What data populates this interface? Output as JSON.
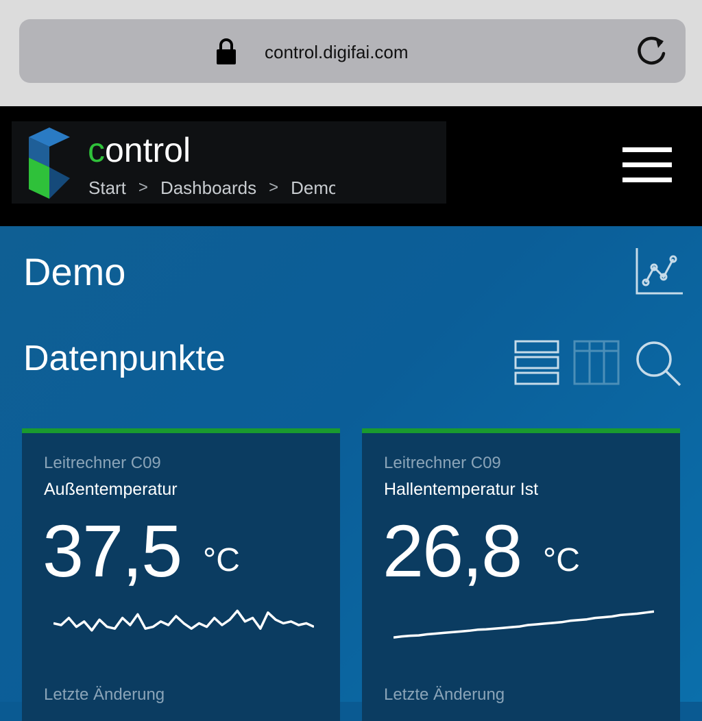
{
  "browser": {
    "url": "control.digifai.com"
  },
  "header": {
    "brand_accent": "c",
    "brand_rest": "ontrol",
    "breadcrumb": [
      "Start",
      "Dashboards",
      "Demo"
    ],
    "accent_color": "#2fc13a"
  },
  "page": {
    "title": "Demo",
    "section_title": "Datenpunkte"
  },
  "cards": [
    {
      "source": "Leitrechner C09",
      "name": "Außentemperatur",
      "value": "37,5",
      "unit": "°C",
      "changed_label": "Letzte Änderung",
      "spark": [
        0.45,
        0.5,
        0.3,
        0.55,
        0.4,
        0.65,
        0.35,
        0.55,
        0.6,
        0.3,
        0.5,
        0.2,
        0.6,
        0.55,
        0.4,
        0.5,
        0.25,
        0.45,
        0.6,
        0.45,
        0.55,
        0.3,
        0.5,
        0.35,
        0.1,
        0.4,
        0.3,
        0.6,
        0.15,
        0.35,
        0.45,
        0.4,
        0.5,
        0.45,
        0.55
      ]
    },
    {
      "source": "Leitrechner C09",
      "name": "Hallentemperatur Ist",
      "value": "26,8",
      "unit": "°C",
      "changed_label": "Letzte Änderung",
      "spark": [
        0.85,
        0.82,
        0.8,
        0.79,
        0.76,
        0.74,
        0.72,
        0.7,
        0.68,
        0.66,
        0.63,
        0.62,
        0.6,
        0.58,
        0.56,
        0.54,
        0.5,
        0.48,
        0.46,
        0.44,
        0.42,
        0.38,
        0.36,
        0.34,
        0.3,
        0.28,
        0.26,
        0.22,
        0.2,
        0.18,
        0.15,
        0.12
      ]
    }
  ],
  "icons": {
    "lock": "lock-icon",
    "reload": "reload-icon",
    "logo": "logo-icon",
    "menu": "menu-icon",
    "chart": "chart-icon",
    "list_view": "list-view-icon",
    "grid_view": "grid-view-icon",
    "search": "search-icon"
  }
}
